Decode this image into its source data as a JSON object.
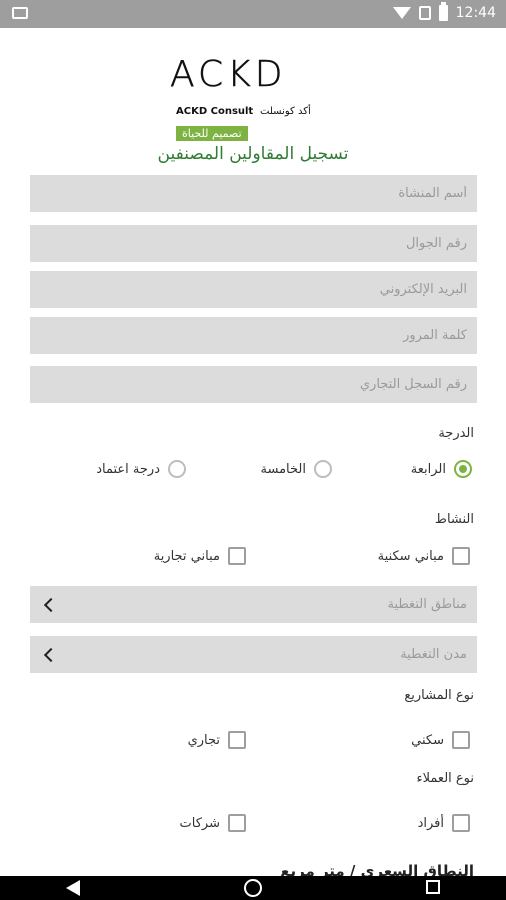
{
  "status_bar": {
    "time": "12:44"
  },
  "logo": {
    "brand": "ACKD",
    "name_en": "ACKD Consult",
    "name_ar": "أكد كونسلت",
    "tagline": "تصميم للحياة"
  },
  "page_title": "تسجيل المقاولين المصنفين",
  "fields": {
    "establishment_name": "أسم المنشأة",
    "mobile": "رقم الجوال",
    "email": "البريد الإلكتروني",
    "password": "كلمة المرور",
    "cr_number": "رقم السجل التجاري"
  },
  "grade": {
    "label": "الدرجة",
    "options": [
      "الرابعة",
      "الخامسة",
      "درجة اعتماد"
    ],
    "selected": "الرابعة"
  },
  "activity": {
    "label": "النشاط",
    "options": [
      "مباني سكنية",
      "مباني تجارية"
    ]
  },
  "coverage": {
    "regions": "مناطق التغطية",
    "cities": "مدن التغطية"
  },
  "project_type": {
    "label": "نوع المشاريع",
    "options": [
      "سكني",
      "تجاري"
    ]
  },
  "client_type": {
    "label": "نوع العملاء",
    "options": [
      "أفراد",
      "شركات"
    ]
  },
  "next_section_partial": "النطاق السعري / متر مربع"
}
